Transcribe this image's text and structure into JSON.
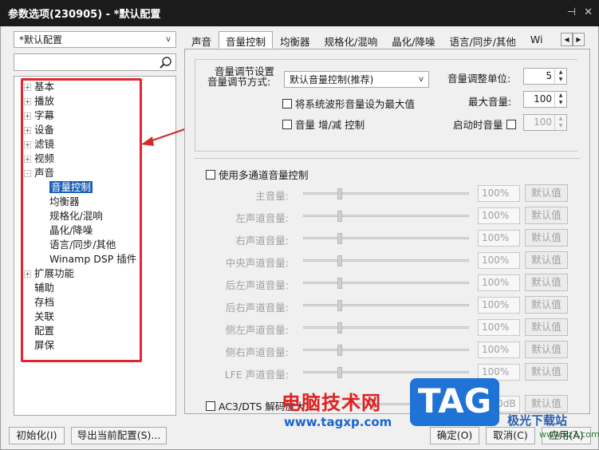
{
  "window": {
    "title": "参数选项(230905) - *默认配置",
    "pin_glyph": "⊣",
    "close_glyph": "✕"
  },
  "profile": {
    "selected": "*默认配置",
    "arrow": "v"
  },
  "tree": [
    {
      "label": "基本",
      "toggle": "+",
      "sel": false
    },
    {
      "label": "播放",
      "toggle": "+",
      "sel": false
    },
    {
      "label": "字幕",
      "toggle": "+",
      "sel": false
    },
    {
      "label": "设备",
      "toggle": "+",
      "sel": false
    },
    {
      "label": "滤镜",
      "toggle": "+",
      "sel": false
    },
    {
      "label": "视频",
      "toggle": "+",
      "sel": false
    },
    {
      "label": "声音",
      "toggle": "-",
      "sel": false
    },
    {
      "label": "音量控制",
      "toggle": "",
      "sel": true,
      "child": true
    },
    {
      "label": "均衡器",
      "toggle": "",
      "sel": false,
      "child": true
    },
    {
      "label": "规格化/混响",
      "toggle": "",
      "sel": false,
      "child": true
    },
    {
      "label": "晶化/降噪",
      "toggle": "",
      "sel": false,
      "child": true
    },
    {
      "label": "语言/同步/其他",
      "toggle": "",
      "sel": false,
      "child": true
    },
    {
      "label": "Winamp DSP 插件",
      "toggle": "",
      "sel": false,
      "child": true
    },
    {
      "label": "扩展功能",
      "toggle": "+",
      "sel": false
    },
    {
      "label": "辅助",
      "toggle": "",
      "sel": false
    },
    {
      "label": "存档",
      "toggle": "",
      "sel": false
    },
    {
      "label": "关联",
      "toggle": "",
      "sel": false
    },
    {
      "label": "配置",
      "toggle": "",
      "sel": false
    },
    {
      "label": "屏保",
      "toggle": "",
      "sel": false
    }
  ],
  "tabs": [
    "声音",
    "音量控制",
    "均衡器",
    "规格化/混响",
    "晶化/降噪",
    "语言/同步/其他",
    "Wi"
  ],
  "active_tab": 1,
  "tabnav": {
    "prev": "◀",
    "next": "▶"
  },
  "volume": {
    "group_title": "音量调节设置",
    "mode_label": "音量调节方式:",
    "mode_value": "默认音量控制(推荐)",
    "mode_arrow": "v",
    "wave_max_label": "将系统波形音量设为最大值",
    "hotkey_label": "音量 增/减 控制",
    "unit_label": "音量调整单位:",
    "unit_value": "5",
    "max_label": "最大音量:",
    "max_value": "100",
    "startup_label": "启动时音量",
    "startup_value": "100"
  },
  "multichannel": {
    "label": "使用多通道音量控制",
    "rows": [
      {
        "name": "主音量:",
        "value": "100%",
        "button": "默认值",
        "level": 0.2
      },
      {
        "name": "左声道音量:",
        "value": "100%",
        "button": "默认值",
        "level": 0.2
      },
      {
        "name": "右声道音量:",
        "value": "100%",
        "button": "默认值",
        "level": 0.2
      },
      {
        "name": "中央声道音量:",
        "value": "100%",
        "button": "默认值",
        "level": 0.2
      },
      {
        "name": "后左声道音量:",
        "value": "100%",
        "button": "默认值",
        "level": 0.2
      },
      {
        "name": "后右声道音量:",
        "value": "100%",
        "button": "默认值",
        "level": 0.2
      },
      {
        "name": "侧左声道音量:",
        "value": "100%",
        "button": "默认值",
        "level": 0.2
      },
      {
        "name": "侧右声道音量:",
        "value": "100%",
        "button": "默认值",
        "level": 0.2
      },
      {
        "name": "LFE 声道音量:",
        "value": "100%",
        "button": "默认值",
        "level": 0.2
      }
    ]
  },
  "ac3": {
    "label": "AC3/DTS 解码放大",
    "value": "10.0dB",
    "button": "默认值",
    "level": 0.2
  },
  "buttons": {
    "init": "初始化(I)",
    "export": "导出当前配置(S)...",
    "ok": "确定(O)",
    "cancel": "取消(C)",
    "apply": "应用(A)"
  },
  "watermark": {
    "cn": "电脑技术网",
    "url": "www.tagxp.com",
    "logo": "TAG",
    "side": "极光下载站",
    "side2": "www.xz7.com"
  },
  "colors": {
    "highlight": "#e2262f",
    "selection": "#1a5fb4",
    "arrow": "#d42a2a"
  }
}
